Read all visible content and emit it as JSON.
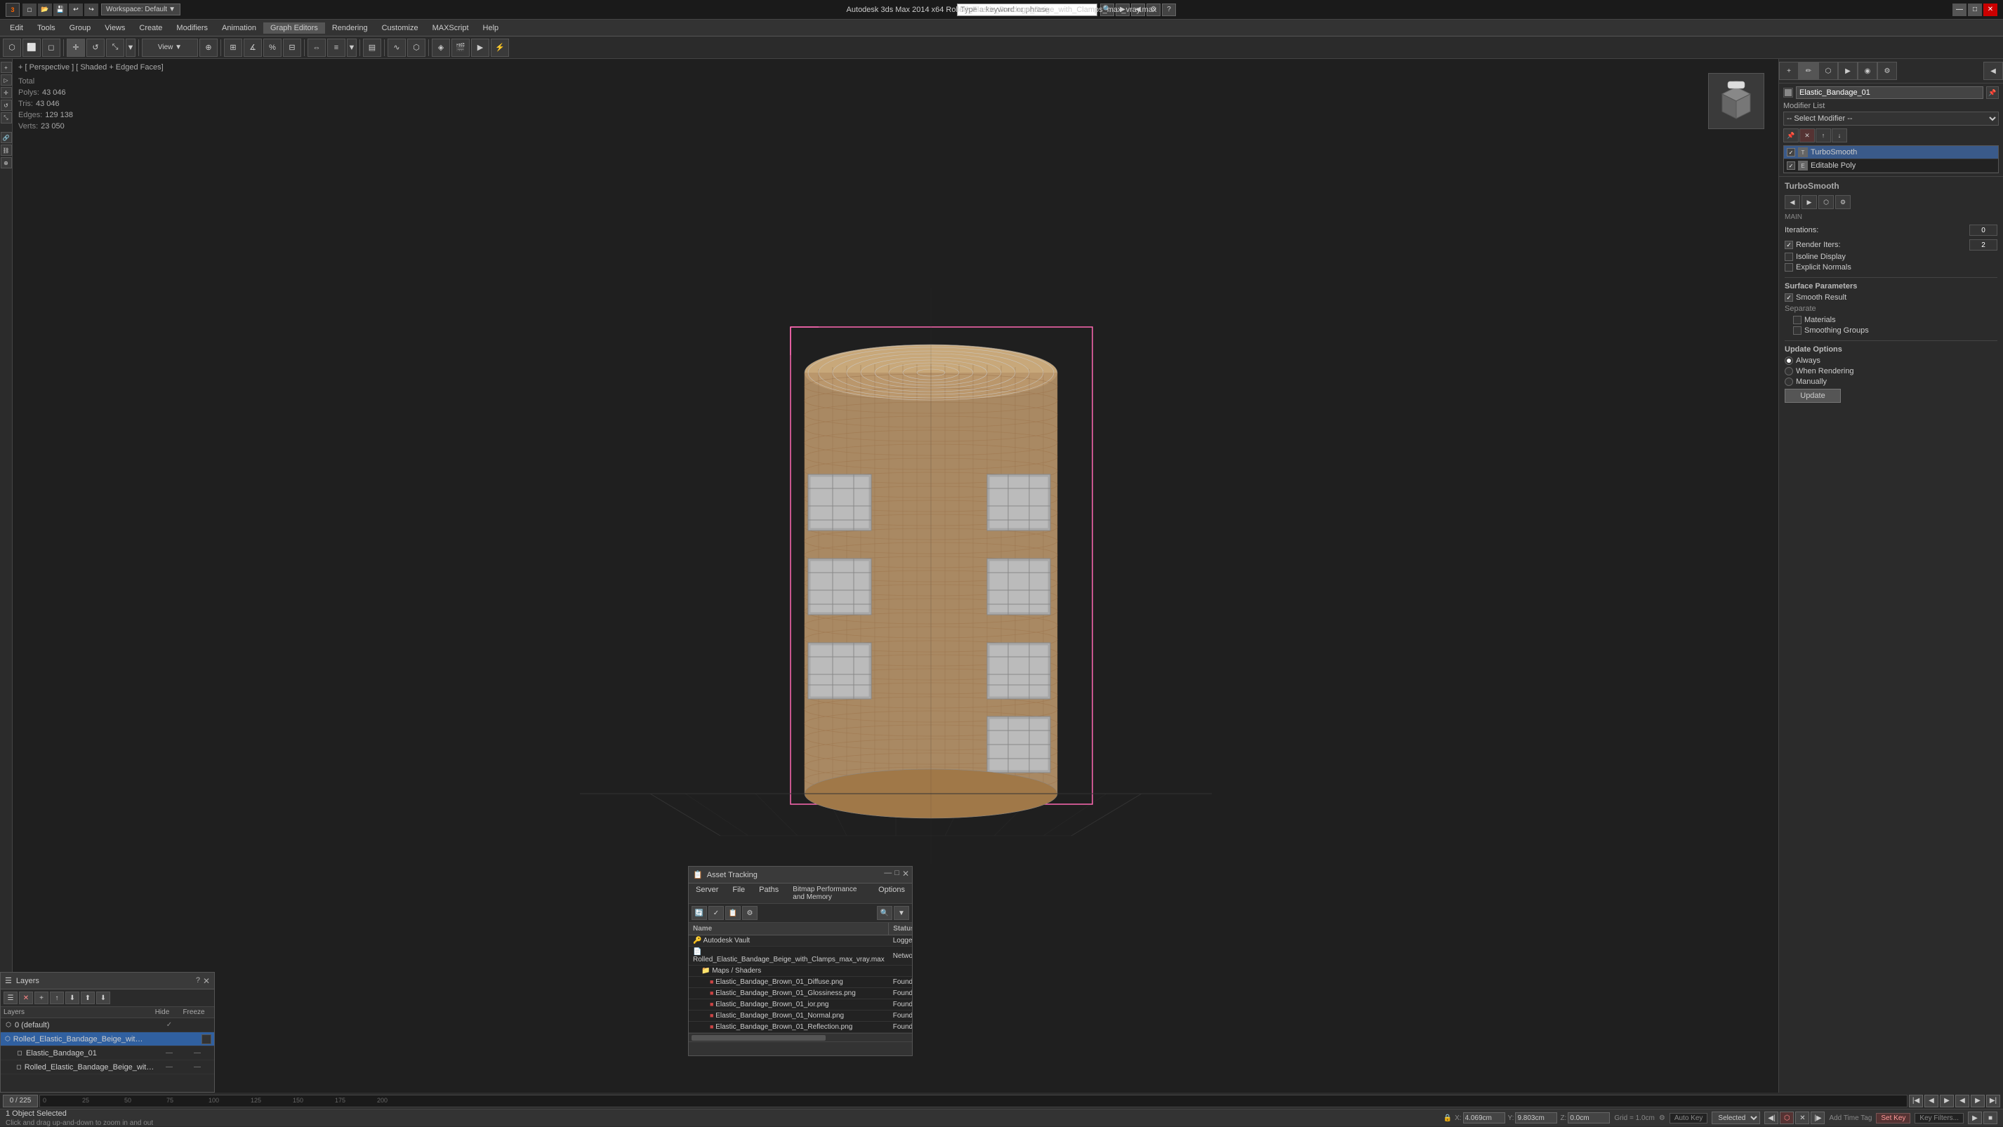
{
  "titlebar": {
    "app_icon": "3ds",
    "workspace_label": "Workspace: Default",
    "title": "Autodesk 3ds Max 2014 x64    Rolled_Elastic_Bandage_Beige_with_Clamps_max_vray.max",
    "search_placeholder": "Type a keyword or phrase",
    "minimize": "—",
    "maximize": "□",
    "close": "✕"
  },
  "menubar": {
    "items": [
      "Edit",
      "Tools",
      "Group",
      "Views",
      "Create",
      "Modifiers",
      "Animation",
      "Graph Editors",
      "Rendering",
      "Customize",
      "MAXScript",
      "Help"
    ]
  },
  "viewport": {
    "label": "+ [ Perspective ] [ Shaded + Edged Faces]",
    "stats": {
      "total": "Total",
      "polys_label": "Polys:",
      "polys": "43 046",
      "tris_label": "Tris:",
      "tris": "43 046",
      "edges_label": "Edges:",
      "edges": "129 138",
      "verts_label": "Verts:",
      "verts": "23 050"
    }
  },
  "rightpanel": {
    "object_name": "Elastic_Bandage_01",
    "modifier_list_label": "Modifier List",
    "modifiers": [
      {
        "name": "TurboSmooth",
        "enabled": true
      },
      {
        "name": "Editable Poly",
        "enabled": true
      }
    ],
    "turbosmooth": {
      "title": "TurboSmooth",
      "main_label": "Main",
      "iterations_label": "Iterations:",
      "iterations_value": "0",
      "render_iters_label": "Render Iters:",
      "render_iters_value": "2",
      "isoline_display_label": "Isoline Display",
      "explicit_normals_label": "Explicit Normals",
      "surface_parameters_label": "Surface Parameters",
      "smooth_result_label": "Smooth Result",
      "smooth_result_checked": true,
      "separate_label": "Separate",
      "materials_label": "Materials",
      "smoothing_groups_label": "Smoothing Groups",
      "update_options_label": "Update Options",
      "always_label": "Always",
      "when_rendering_label": "When Rendering",
      "manually_label": "Manually",
      "update_label": "Update"
    }
  },
  "layers_panel": {
    "title": "Layers",
    "help": "?",
    "toolbar_icons": [
      "☰",
      "✕",
      "+",
      "↑",
      "↓",
      "⬆",
      "⬇"
    ],
    "headers": {
      "name": "Layers",
      "hide": "Hide",
      "freeze": "Freeze"
    },
    "items": [
      {
        "indent": 0,
        "name": "0 (default)",
        "checked": true,
        "selected": false,
        "icon": "◻"
      },
      {
        "indent": 0,
        "name": "Rolled_Elastic_Bandage_Beige_with_Clamps",
        "checked": false,
        "selected": true,
        "icon": "◻"
      },
      {
        "indent": 1,
        "name": "Elastic_Bandage_01",
        "selected": false,
        "icon": "◻"
      },
      {
        "indent": 1,
        "name": "Rolled_Elastic_Bandage_Beige_with_Clamps",
        "selected": false,
        "icon": "◻"
      }
    ]
  },
  "asset_panel": {
    "title": "Asset Tracking",
    "menu_items": [
      "Server",
      "File",
      "Paths",
      "Bitmap Performance and Memory",
      "Options"
    ],
    "columns": {
      "name": "Name",
      "status": "Status"
    },
    "items": [
      {
        "level": 0,
        "name": "Autodesk Vault",
        "status": "Logged",
        "status_class": "status-logged",
        "icon": "🔑"
      },
      {
        "level": 0,
        "name": "Rolled_Elastic_Bandage_Beige_with_Clamps_max_vray.max",
        "status": "Network",
        "status_class": "status-network",
        "icon": "📄"
      },
      {
        "level": 1,
        "name": "Maps / Shaders",
        "status": "",
        "icon": "📁"
      },
      {
        "level": 2,
        "name": "Elastic_Bandage_Brown_01_Diffuse.png",
        "status": "Found",
        "status_class": "status-found",
        "icon": "🖼"
      },
      {
        "level": 2,
        "name": "Elastic_Bandage_Brown_01_Glossiness.png",
        "status": "Found",
        "status_class": "status-found",
        "icon": "🖼"
      },
      {
        "level": 2,
        "name": "Elastic_Bandage_Brown_01_ior.png",
        "status": "Found",
        "status_class": "status-found",
        "icon": "🖼"
      },
      {
        "level": 2,
        "name": "Elastic_Bandage_Brown_01_Normal.png",
        "status": "Found",
        "status_class": "status-found",
        "icon": "🖼"
      },
      {
        "level": 2,
        "name": "Elastic_Bandage_Brown_01_Reflection.png",
        "status": "Found",
        "status_class": "status-found",
        "icon": "🖼"
      }
    ]
  },
  "statusbar": {
    "objects_selected": "1 Object Selected",
    "hint": "Click and drag up-and-down to zoom in and out",
    "x_label": "X:",
    "x_value": "4.069cm",
    "y_label": "Y:",
    "y_value": "9.803cm",
    "z_label": "Z:",
    "z_value": "0.0cm",
    "grid_label": "Grid = 1.0cm",
    "autokey": "Auto Key",
    "selected_label": "Selected",
    "addtimetag": "Add Time Tag",
    "setkey": "Set Key",
    "keyfilters": "Key Filters...",
    "time_range": "0 / 225"
  },
  "icons": {
    "search": "🔍",
    "gear": "⚙",
    "layers": "📋",
    "close": "✕",
    "help": "?",
    "cube": "⬡",
    "play": "▶",
    "prev": "◀◀",
    "next": "▶▶",
    "first": "|◀",
    "last": "▶|"
  }
}
